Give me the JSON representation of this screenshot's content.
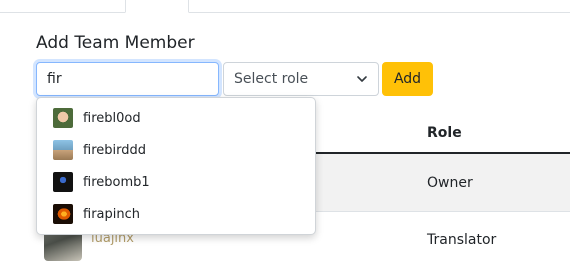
{
  "heading": "Add Team Member",
  "search": {
    "value": "fir"
  },
  "role_select": {
    "selected": "Select role"
  },
  "add_button": "Add",
  "table": {
    "header_role": "Role",
    "rows": [
      {
        "user": "",
        "role": "Owner"
      },
      {
        "user": "luajinx",
        "role": "Translator"
      }
    ]
  },
  "suggestions": [
    {
      "name": "firebl0od"
    },
    {
      "name": "firebirddd"
    },
    {
      "name": "firebomb1"
    },
    {
      "name": "firapinch"
    }
  ]
}
